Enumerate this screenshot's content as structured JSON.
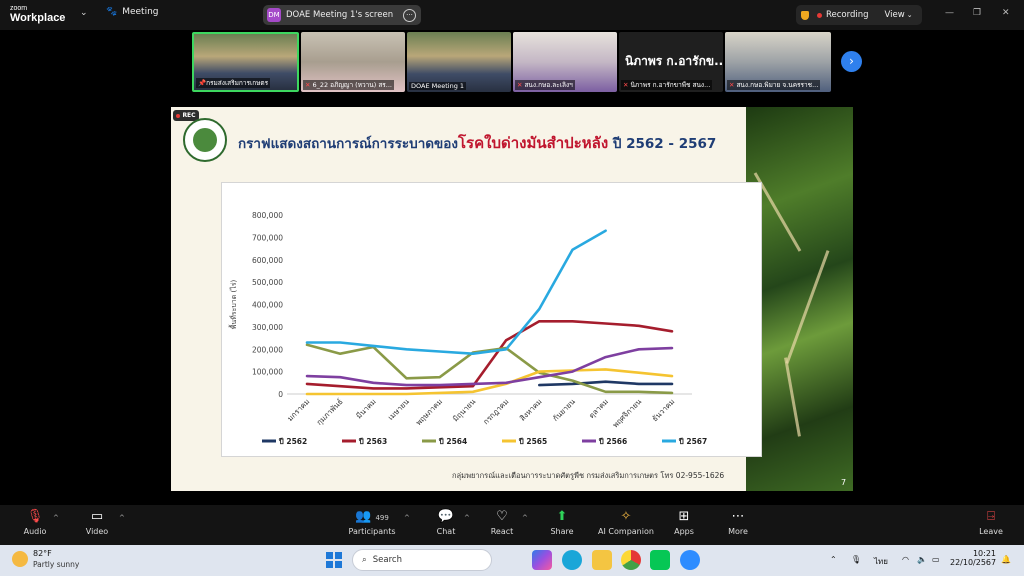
{
  "app": {
    "logo_line1": "zoom",
    "logo_line2": "Workplace"
  },
  "topbar": {
    "meeting_label": "Meeting",
    "screen_initials": "DM",
    "screen_label": "DOAE Meeting 1's screen",
    "recording_label": "Recording",
    "view_label": "View"
  },
  "participants": [
    {
      "name": "กรมส่งเสริมการเกษตร",
      "muted": false
    },
    {
      "name": "6_22 อภิญญา (หวาน) สร...",
      "muted": true
    },
    {
      "name": "DOAE Meeting 1",
      "muted": false
    },
    {
      "name": "สนง.กษอ.ละเลิงฯ",
      "muted": true
    },
    {
      "name": "นิภาพร ก.อารักขาพืช สนง...",
      "muted": true,
      "display_name": "นิภาพร ก.อารักข..."
    },
    {
      "name": "สนง.กษอ.พิมาย จ.นครราช...",
      "muted": true
    }
  ],
  "slide": {
    "rec_label": "REC",
    "title_pre": "กราฟแสดงสถานการณ์การระบาดของ",
    "title_highlight": "โรคใบด่างมันสำปะหลัง",
    "title_post": " ปี 2562 - 2567",
    "source": "กลุ่มพยากรณ์และเตือนการระบาดศัตรูพืช กรมส่งเสริมการเกษตร โทร 02-955-1626",
    "slide_number": "7"
  },
  "chart_data": {
    "type": "line",
    "ylabel": "พื้นที่ระบาด (ไร่)",
    "ylim": [
      0,
      800000
    ],
    "yticks": [
      "0",
      "100,000",
      "200,000",
      "300,000",
      "400,000",
      "500,000",
      "600,000",
      "700,000",
      "800,000"
    ],
    "categories": [
      "มกราคม",
      "กุมภาพันธ์",
      "มีนาคม",
      "เมษายน",
      "พฤษภาคม",
      "มิถุนายน",
      "กรกฎาคม",
      "สิงหาคม",
      "กันยายน",
      "ตุลาคม",
      "พฤศจิกายน",
      "ธันวาคม"
    ],
    "legend_position": "bottom",
    "series": [
      {
        "name": "ปี 2562",
        "color": "#1f3864",
        "values": [
          null,
          null,
          null,
          null,
          null,
          null,
          null,
          40000,
          45000,
          55000,
          45000,
          45000
        ]
      },
      {
        "name": "ปี 2563",
        "color": "#a51d2d",
        "values": [
          45000,
          35000,
          25000,
          25000,
          30000,
          35000,
          240000,
          325000,
          325000,
          315000,
          305000,
          280000
        ]
      },
      {
        "name": "ปี 2564",
        "color": "#8a9a47",
        "values": [
          220000,
          180000,
          210000,
          70000,
          75000,
          185000,
          205000,
          95000,
          60000,
          10000,
          10000,
          5000
        ]
      },
      {
        "name": "ปี 2565",
        "color": "#f5c431",
        "values": [
          0,
          0,
          0,
          0,
          5000,
          10000,
          45000,
          100000,
          105000,
          110000,
          95000,
          80000
        ]
      },
      {
        "name": "ปี 2566",
        "color": "#7e3fa0",
        "values": [
          80000,
          75000,
          50000,
          40000,
          40000,
          45000,
          50000,
          75000,
          100000,
          165000,
          200000,
          205000
        ]
      },
      {
        "name": "ปี 2567",
        "color": "#29a9e0",
        "values": [
          230000,
          230000,
          215000,
          200000,
          190000,
          180000,
          200000,
          380000,
          645000,
          730000,
          null,
          null
        ]
      }
    ]
  },
  "toolbar": {
    "audio": "Audio",
    "video": "Video",
    "participants": "Participants",
    "participant_count": "499",
    "chat": "Chat",
    "react": "React",
    "share": "Share",
    "ai_companion": "AI Companion",
    "apps": "Apps",
    "more": "More",
    "leave": "Leave"
  },
  "taskbar": {
    "temperature": "82°F",
    "weather": "Partly sunny",
    "search_placeholder": "Search",
    "language": "ไทย",
    "time": "10:21",
    "date": "22/10/2567"
  }
}
